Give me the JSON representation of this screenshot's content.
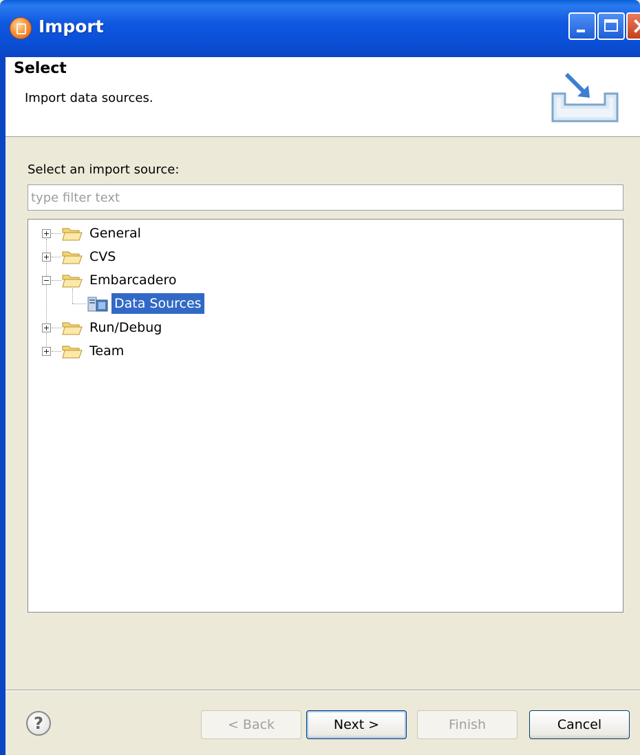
{
  "window": {
    "title": "Import",
    "icon": "eclipse-app-icon"
  },
  "header": {
    "title": "Select",
    "description": "Import data sources.",
    "graphic": "import-wizard-icon"
  },
  "body": {
    "select_label": "Select an import source:",
    "filter_placeholder": "type filter text",
    "filter_value": ""
  },
  "tree": {
    "items": [
      {
        "label": "General",
        "expanded": false
      },
      {
        "label": "CVS",
        "expanded": false
      },
      {
        "label": "Embarcadero",
        "expanded": true,
        "children": [
          {
            "label": "Data Sources",
            "selected": true
          }
        ]
      },
      {
        "label": "Run/Debug",
        "expanded": false
      },
      {
        "label": "Team",
        "expanded": false
      }
    ]
  },
  "footer": {
    "help_label": "?",
    "back_label": "< Back",
    "next_label": "Next >",
    "finish_label": "Finish",
    "cancel_label": "Cancel"
  },
  "colors": {
    "title_bar": "#0a4fd6",
    "selection": "#3169c6",
    "dialog_bg": "#ece9d8"
  }
}
